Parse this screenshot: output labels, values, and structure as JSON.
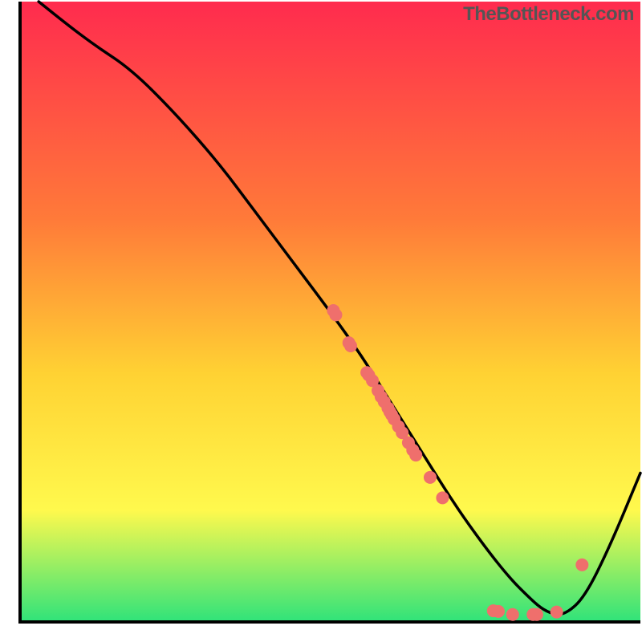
{
  "watermark": "TheBottleneck.com",
  "chart_data": {
    "type": "line",
    "title": "",
    "xlabel": "",
    "ylabel": "",
    "xlim": [
      0,
      100
    ],
    "ylim": [
      0,
      100
    ],
    "grid": false,
    "legend": false,
    "background_gradient": {
      "top": "#ff2b4e",
      "mid1": "#ff7a39",
      "mid2": "#ffd233",
      "mid3": "#fff94d",
      "bottom": "#2fe37a"
    },
    "curve_x": [
      3,
      8,
      12,
      18,
      25,
      32,
      38,
      44,
      50,
      55,
      60,
      65,
      70,
      75,
      79,
      82,
      84,
      86,
      88,
      91,
      95,
      100
    ],
    "curve_y": [
      100,
      96,
      93,
      89,
      82,
      74,
      66,
      58,
      50,
      43,
      35,
      27,
      19,
      12,
      7,
      4,
      2.2,
      1.2,
      1.3,
      4,
      12,
      24
    ],
    "point_color": "#ef6f6c",
    "points": [
      {
        "x": 50.5,
        "y": 50.2
      },
      {
        "x": 50.9,
        "y": 49.5
      },
      {
        "x": 53.0,
        "y": 45.0
      },
      {
        "x": 53.3,
        "y": 44.5
      },
      {
        "x": 55.9,
        "y": 40.2
      },
      {
        "x": 56.2,
        "y": 39.8
      },
      {
        "x": 56.8,
        "y": 38.9
      },
      {
        "x": 57.7,
        "y": 37.3
      },
      {
        "x": 58.2,
        "y": 36.3
      },
      {
        "x": 58.7,
        "y": 35.5
      },
      {
        "x": 59.3,
        "y": 34.5
      },
      {
        "x": 59.6,
        "y": 33.9
      },
      {
        "x": 59.9,
        "y": 33.4
      },
      {
        "x": 60.3,
        "y": 32.7
      },
      {
        "x": 61.0,
        "y": 31.5
      },
      {
        "x": 61.6,
        "y": 30.5
      },
      {
        "x": 62.6,
        "y": 28.9
      },
      {
        "x": 63.3,
        "y": 27.7
      },
      {
        "x": 63.8,
        "y": 26.9
      },
      {
        "x": 66.1,
        "y": 23.3
      },
      {
        "x": 68.1,
        "y": 20.0
      },
      {
        "x": 76.3,
        "y": 1.8
      },
      {
        "x": 77.1,
        "y": 1.7
      },
      {
        "x": 79.4,
        "y": 1.2
      },
      {
        "x": 82.7,
        "y": 1.2
      },
      {
        "x": 83.3,
        "y": 1.2
      },
      {
        "x": 86.5,
        "y": 1.6
      },
      {
        "x": 90.6,
        "y": 9.2
      }
    ]
  }
}
